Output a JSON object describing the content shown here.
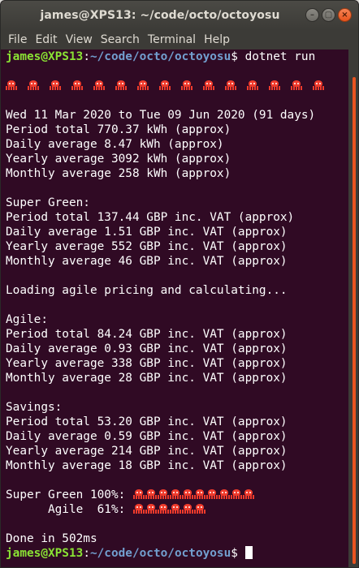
{
  "window": {
    "title": "james@XPS13: ~/code/octo/octoyosu",
    "buttons": {
      "minimize": "–",
      "maximize": "▢",
      "close": "×"
    }
  },
  "menu": [
    "File",
    "Edit",
    "View",
    "Search",
    "Terminal",
    "Help"
  ],
  "prompt": {
    "user": "james@XPS13",
    "path": "~/code/octo/octoyosu",
    "symbol": "$"
  },
  "commands": {
    "first": " dotnet run"
  },
  "banner_count": 15,
  "output": {
    "range": "Wed 11 Mar 2020 to Tue 09 Jun 2020 (91 days)",
    "usage": [
      "Period total 770.37 kWh (approx)",
      "Daily average 8.47 kWh (approx)",
      "Yearly average 3092 kWh (approx)",
      "Monthly average 258 kWh (approx)"
    ],
    "super_green": {
      "heading": "Super Green:",
      "lines": [
        "Period total 137.44 GBP inc. VAT (approx)",
        "Daily average 1.51 GBP inc. VAT (approx)",
        "Yearly average 552 GBP inc. VAT (approx)",
        "Monthly average 46 GBP inc. VAT (approx)"
      ]
    },
    "loading": "Loading agile pricing and calculating...",
    "agile": {
      "heading": "Agile:",
      "lines": [
        "Period total 84.24 GBP inc. VAT (approx)",
        "Daily average 0.93 GBP inc. VAT (approx)",
        "Yearly average 338 GBP inc. VAT (approx)",
        "Monthly average 28 GBP inc. VAT (approx)"
      ]
    },
    "savings": {
      "heading": "Savings:",
      "lines": [
        "Period total 53.20 GBP inc. VAT (approx)",
        "Daily average 0.59 GBP inc. VAT (approx)",
        "Yearly average 214 GBP inc. VAT (approx)",
        "Monthly average 18 GBP inc. VAT (approx)"
      ]
    },
    "comparison": [
      {
        "label": "Super Green 100%:",
        "count": 10
      },
      {
        "label": "      Agile  61%:",
        "count": 6
      }
    ],
    "done": "Done in 502ms"
  },
  "colors": {
    "background": "#300a24",
    "prompt_user": "#8ae234",
    "prompt_path": "#729fcf",
    "octopus": "#f03b2c",
    "scroll_thumb": "#e95420"
  },
  "icons": {
    "octopus": "octopus-icon"
  }
}
